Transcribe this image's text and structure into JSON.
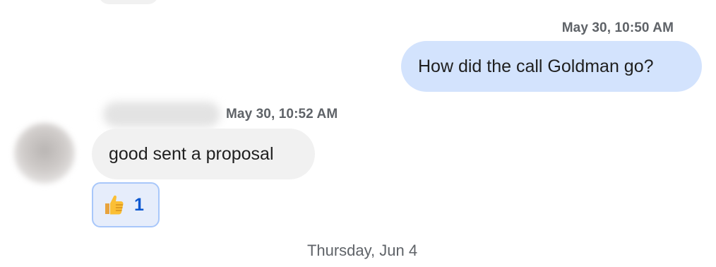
{
  "messages": [
    {
      "direction": "outgoing",
      "timestamp": "May 30, 10:50 AM",
      "text": "How did the call Goldman go?"
    },
    {
      "direction": "incoming",
      "timestamp": "May 30, 10:52 AM",
      "text": "good sent a proposal",
      "reaction": {
        "icon": "thumbs-up-icon",
        "count": "1"
      }
    }
  ],
  "date_divider": "Thursday, Jun 4",
  "colors": {
    "outgoing_bubble": "#d3e3fd",
    "incoming_bubble": "#f1f1f1",
    "reaction_border": "#a8c7fa",
    "reaction_count": "#0b57d0",
    "timestamp": "#5f6368"
  }
}
